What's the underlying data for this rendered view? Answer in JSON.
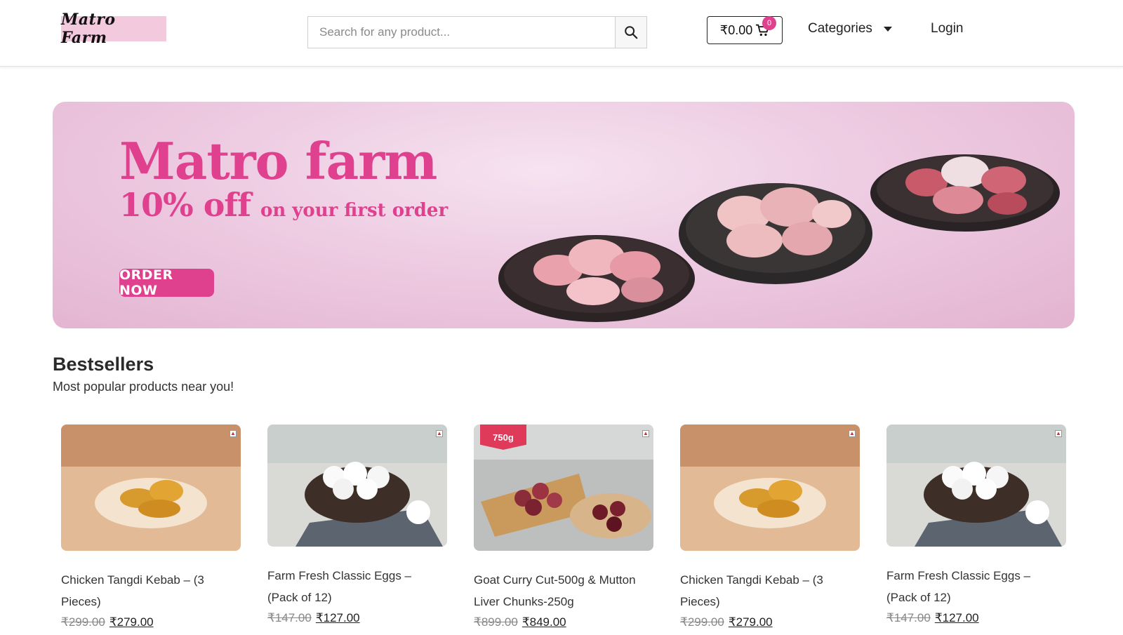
{
  "header": {
    "logo_text": "Matro Farm",
    "search": {
      "placeholder": "Search for any product..."
    },
    "cart": {
      "total": "₹0.00",
      "count": "0"
    },
    "nav": {
      "categories_label": "Categories",
      "login_label": "Login"
    }
  },
  "banner": {
    "title": "Matro farm",
    "offer_big": "10% off",
    "offer_small": "on your first order",
    "cta": "ORDER NOW"
  },
  "bestsellers": {
    "title": "Bestsellers",
    "subtitle": "Most popular products near you!",
    "products": [
      {
        "name": "Chicken Tangdi Kebab – (3 Pieces)",
        "old_price": "₹299.00",
        "price": "₹279.00",
        "image": "chicken-kebab"
      },
      {
        "name": "Farm Fresh Classic Eggs – (Pack of 12)",
        "old_price": "₹147.00",
        "price": "₹127.00",
        "image": "eggs"
      },
      {
        "name": "Goat Curry Cut-500g & Mutton Liver Chunks-250g",
        "old_price": "₹899.00",
        "price": "₹849.00",
        "image": "mutton",
        "badge": "750g"
      },
      {
        "name": "Chicken Tangdi Kebab – (3 Pieces)",
        "old_price": "₹299.00",
        "price": "₹279.00",
        "image": "chicken-kebab"
      },
      {
        "name": "Farm Fresh Classic Eggs – (Pack of 12)",
        "old_price": "₹147.00",
        "price": "₹127.00",
        "image": "eggs"
      }
    ]
  },
  "colors": {
    "brand_pink": "#e0418f",
    "banner_bg": "#eecde3"
  }
}
